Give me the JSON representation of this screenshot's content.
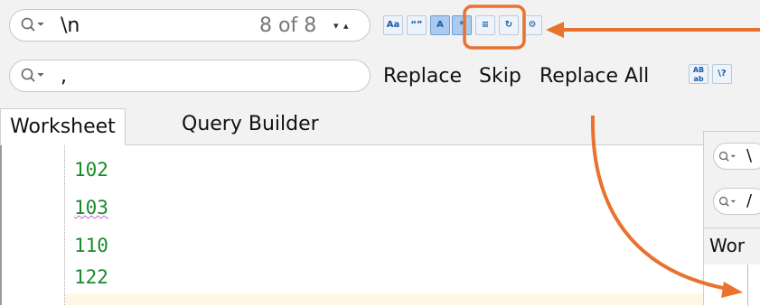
{
  "find_bar": {
    "search_value": "\\n",
    "match_count": "8 of 8",
    "nav_arrows": "▾ ▴",
    "options": [
      {
        "label": "Aa",
        "name": "match-case-button",
        "active": false
      },
      {
        "label": "“”",
        "name": "whole-word-button",
        "active": false
      },
      {
        "label": "A",
        "name": "highlight-button",
        "active": true
      },
      {
        "label": "*",
        "name": "regex-button",
        "active": true
      },
      {
        "label": "≡",
        "name": "selection-only-button",
        "active": false
      },
      {
        "label": "↻",
        "name": "wrap-search-button",
        "active": false
      },
      {
        "label": "⚙",
        "name": "extra-options-button",
        "active": false
      }
    ]
  },
  "replace_bar": {
    "replace_value": ",",
    "replace_label": "Replace",
    "skip_label": "Skip",
    "replace_all_label": "Replace All",
    "preserve_case_label": "AB ab",
    "help_label": "\\?"
  },
  "tabs": [
    {
      "label": "Worksheet",
      "active": true
    },
    {
      "label": "Query Builder",
      "active": false
    }
  ],
  "editor": {
    "lines": [
      "102",
      "103",
      "110",
      "122"
    ]
  },
  "inset": {
    "search_value": "\\",
    "replace_value": "/",
    "tab_label": "Wor"
  },
  "colors": {
    "annotation": "#e8722e",
    "code_text": "#1a8a2b",
    "current_line": "#fff7e3"
  }
}
